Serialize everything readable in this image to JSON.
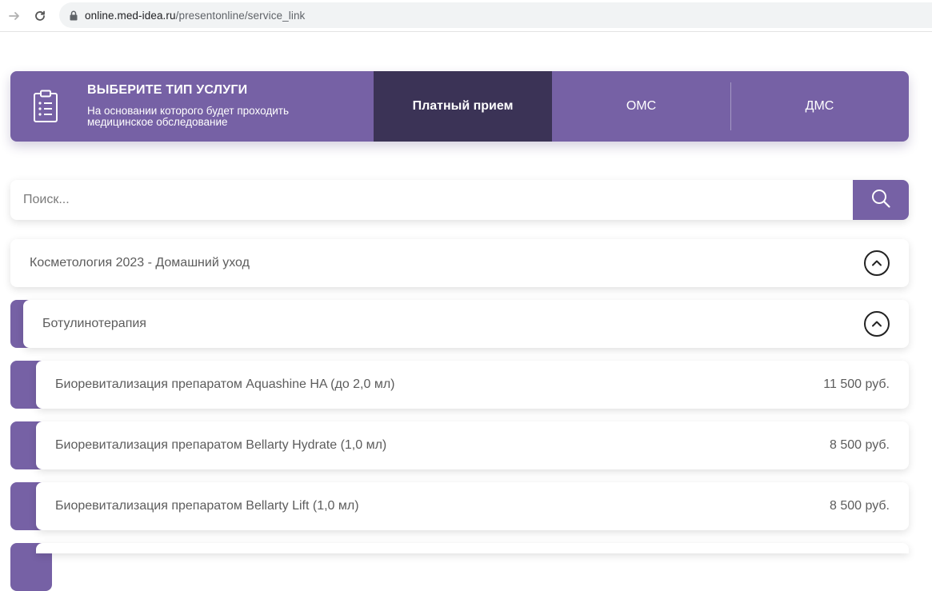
{
  "browser": {
    "url_host": "online.med-idea.ru",
    "url_path": "/presentonline/service_link"
  },
  "type_panel": {
    "title": "ВЫБЕРИТЕ ТИП УСЛУГИ",
    "subtitle": "На основании которого будет проходить медицинское обследование",
    "tabs": [
      {
        "label": "Платный прием",
        "active": true
      },
      {
        "label": "ОМС",
        "active": false
      },
      {
        "label": "ДМС",
        "active": false
      }
    ]
  },
  "search": {
    "placeholder": "Поиск..."
  },
  "categories": [
    {
      "label": "Косметология 2023 - Домашний уход",
      "expanded": true
    },
    {
      "label": "Ботулинотерапия",
      "expanded": true
    }
  ],
  "services": [
    {
      "name": "Биоревитализация препаратом Aquashine HA (до 2,0 мл)",
      "price": "11 500 руб."
    },
    {
      "name": "Биоревитализация препаратом Bellarty Hydrate (1,0 мл)",
      "price": "8 500 руб."
    },
    {
      "name": "Биоревитализация препаратом Bellarty Lift (1,0 мл)",
      "price": "8 500 руб."
    }
  ],
  "colors": {
    "accent": "#7661a5",
    "active_tab": "#3b3356"
  },
  "icons": {
    "forward": "arrow-right-icon",
    "reload": "reload-icon",
    "lock": "lock-icon",
    "clipboard": "clipboard-list-icon",
    "search": "search-icon",
    "collapse": "chevron-up-circle-icon"
  }
}
